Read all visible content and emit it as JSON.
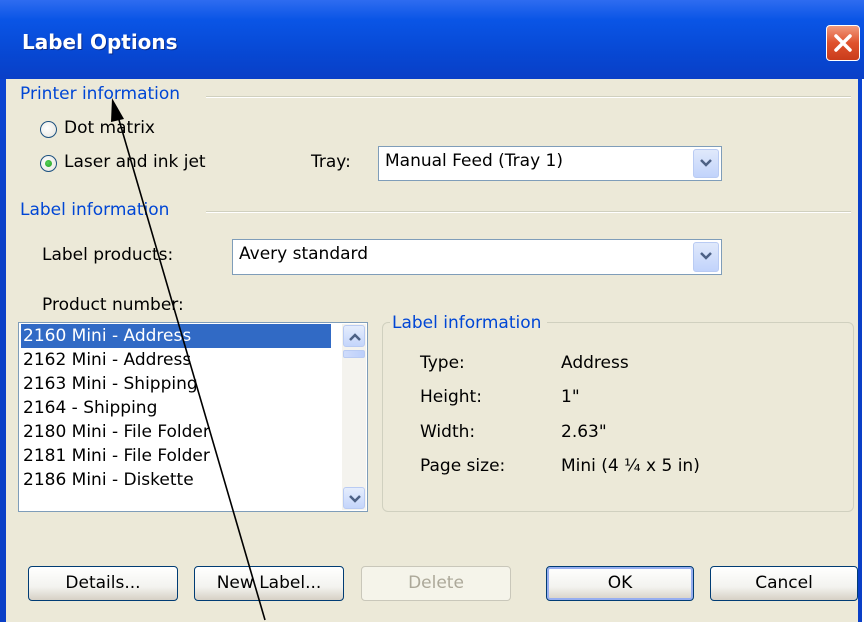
{
  "window": {
    "title": "Label Options"
  },
  "printer": {
    "group_label": "Printer information",
    "options": [
      "Dot matrix",
      "Laser and ink jet"
    ],
    "selected": "Laser and ink jet",
    "tray_label": "Tray:",
    "tray_value": "Manual Feed (Tray 1)"
  },
  "label": {
    "group_label": "Label information",
    "products_label": "Label products:",
    "products_value": "Avery standard",
    "product_number_label": "Product number:",
    "product_numbers": [
      "2160 Mini - Address",
      "2162 Mini - Address",
      "2163 Mini - Shipping",
      "2164 - Shipping",
      "2180 Mini - File Folder",
      "2181 Mini - File Folder",
      "2186 Mini - Diskette"
    ],
    "selected_product": "2160 Mini - Address"
  },
  "info": {
    "title": "Label information",
    "rows": [
      {
        "key": "Type:",
        "value": "Address"
      },
      {
        "key": "Height:",
        "value": "1\""
      },
      {
        "key": "Width:",
        "value": "2.63\""
      },
      {
        "key": "Page size:",
        "value": "Mini (4 ¼ x 5 in)"
      }
    ]
  },
  "buttons": {
    "details": "Details...",
    "new_label": "New Label...",
    "delete": "Delete",
    "ok": "OK",
    "cancel": "Cancel"
  },
  "colors": {
    "title_bar": "#0a55e6",
    "group_label": "#0046d5",
    "selection": "#316ac5",
    "dialog_face": "#ece9d8"
  },
  "icons": {
    "close": "close-icon",
    "dropdown": "chevron-down-icon",
    "scroll_up": "scroll-up-icon",
    "scroll_down": "scroll-down-icon",
    "overlay": "annotation-arrow-icon"
  }
}
